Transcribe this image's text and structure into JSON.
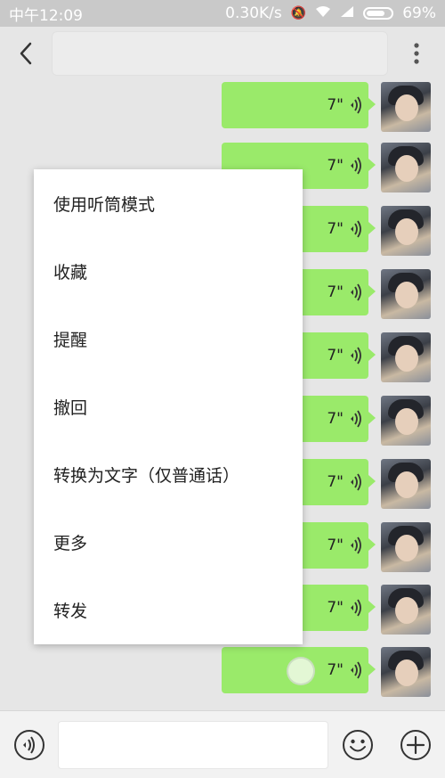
{
  "status_bar": {
    "time": "中午12:09",
    "network_speed": "0.30K/s",
    "battery": "69%"
  },
  "header": {
    "title": ""
  },
  "messages": [
    {
      "duration": "7\""
    },
    {
      "duration": "7\""
    },
    {
      "duration": "7\""
    },
    {
      "duration": "7\""
    },
    {
      "duration": "7\""
    },
    {
      "duration": "7\""
    },
    {
      "duration": "7\""
    },
    {
      "duration": "7\""
    },
    {
      "duration": "7\""
    },
    {
      "duration": "7\""
    }
  ],
  "context_menu": {
    "items": [
      {
        "label": "使用听筒模式"
      },
      {
        "label": "收藏"
      },
      {
        "label": "提醒"
      },
      {
        "label": "撤回"
      },
      {
        "label": "转换为文字（仅普通话）"
      },
      {
        "label": "更多"
      },
      {
        "label": "转发"
      }
    ]
  },
  "input_bar": {
    "voice_icon": "voice-icon",
    "emoji_icon": "emoji-icon",
    "add_icon": "plus-icon",
    "text_value": ""
  },
  "colors": {
    "bubble": "#9aea6a",
    "status_bar": "#c9c9c9",
    "background": "#e6e6e6"
  }
}
